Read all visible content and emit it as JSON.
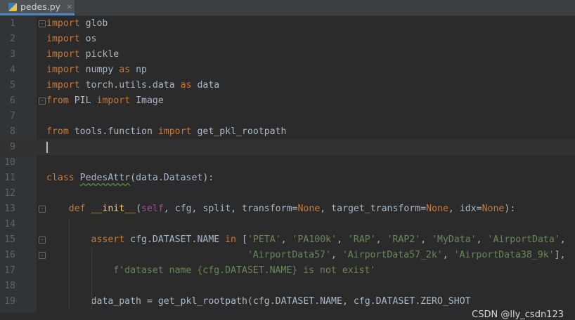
{
  "tab": {
    "filename": "pedes.py",
    "close": "×",
    "icon": "python-file-icon"
  },
  "lines": [
    {
      "n": "1",
      "text": "import glob",
      "fold": true
    },
    {
      "n": "2",
      "text": "import os"
    },
    {
      "n": "3",
      "text": "import pickle"
    },
    {
      "n": "4",
      "text": "import numpy as np"
    },
    {
      "n": "5",
      "text": "import torch.utils.data as data"
    },
    {
      "n": "6",
      "text": "from PIL import Image",
      "fold": true
    },
    {
      "n": "7",
      "text": ""
    },
    {
      "n": "8",
      "text": "from tools.function import get_pkl_rootpath"
    },
    {
      "n": "9",
      "text": "",
      "current": true
    },
    {
      "n": "10",
      "text": ""
    },
    {
      "n": "11",
      "text": "class PedesAttr(data.Dataset):"
    },
    {
      "n": "12",
      "text": ""
    },
    {
      "n": "13",
      "text": "    def __init__(self, cfg, split, transform=None, target_transform=None, idx=None):",
      "fold": true
    },
    {
      "n": "14",
      "text": ""
    },
    {
      "n": "15",
      "text": "        assert cfg.DATASET.NAME in ['PETA', 'PA100k', 'RAP', 'RAP2', 'MyData', 'AirportData',",
      "fold": true
    },
    {
      "n": "16",
      "text": "                                    'AirportData57', 'AirportData57_2k', 'AirportData38_9k'],",
      "fold": true
    },
    {
      "n": "17",
      "text": "            f'dataset name {cfg.DATASET.NAME} is not exist'"
    },
    {
      "n": "18",
      "text": ""
    },
    {
      "n": "19",
      "text": "        data_path = get_pkl_rootpath(cfg.DATASET.NAME, cfg.DATASET.ZERO_SHOT"
    }
  ],
  "watermark": "CSDN @lly_csdn123",
  "colors": {
    "background": "#2b2b2b",
    "keyword": "#cc7832",
    "string": "#6a8759",
    "function": "#ffc66d",
    "self": "#94558d",
    "text": "#a9b7c6"
  }
}
